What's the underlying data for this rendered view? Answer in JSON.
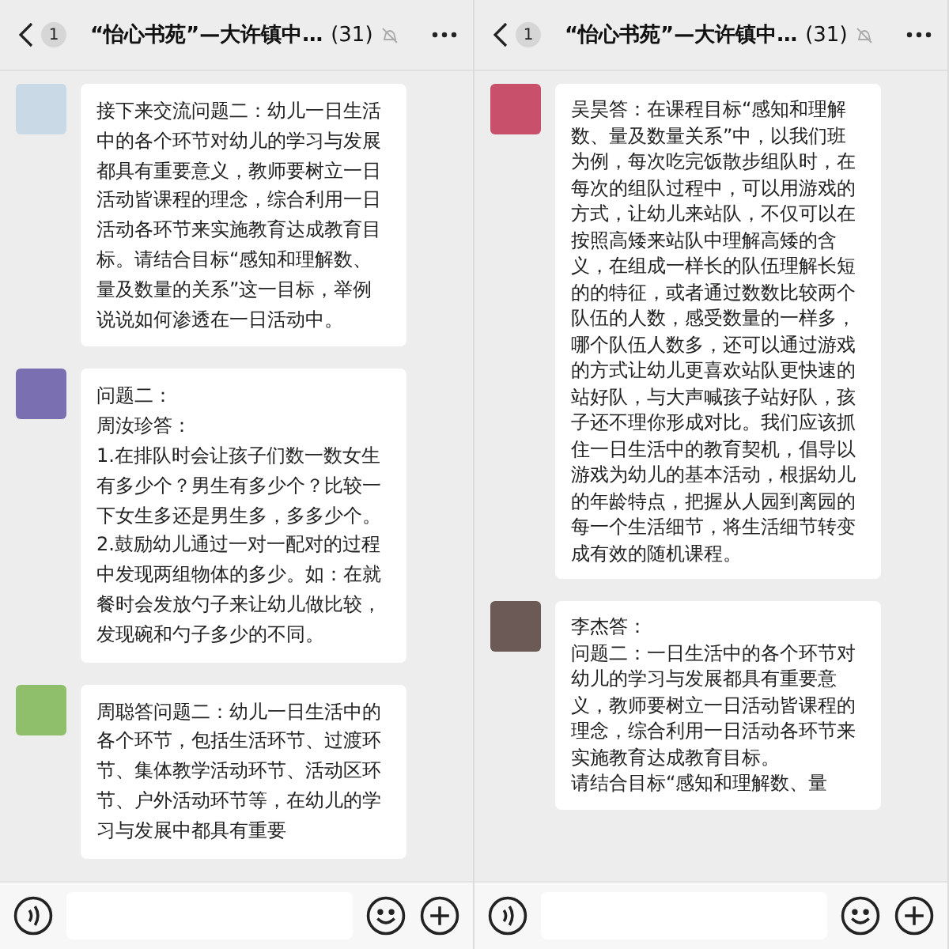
{
  "panes": [
    {
      "header": {
        "unread_count": "1",
        "title": "“怡心书苑”—大许镇中…",
        "member_count": "(31)"
      },
      "messages": [
        {
          "paragraphs": [
            "接下来交流问题二：幼儿一日生活中的各个环节对幼儿的学习与发展都具有重要意义，教师要树立一日活动皆课程的理念，综合利用一日活动各环节来实施教育达成教育目标。请结合目标“感知和理解数、量及数量的关系”这一目标，举例说说如何渗透在一日活动中。"
          ]
        },
        {
          "paragraphs": [
            "问题二：",
            "周汝珍答：",
            "1.在排队时会让孩子们数一数女生有多少个？男生有多少个？比较一下女生多还是男生多，多多少个。",
            "2.鼓励幼儿通过一对一配对的过程中发现两组物体的多少。如：在就餐时会发放勺子来让幼儿做比较，发现碗和勺子多少的不同。"
          ]
        },
        {
          "paragraphs": [
            "周聪答问题二：幼儿一日生活中的各个环节，包括生活环节、过渡环节、集体教学活动环节、活动区环节、户外活动环节等，在幼儿的学习与发展中都具有重要"
          ]
        }
      ]
    },
    {
      "header": {
        "unread_count": "1",
        "title": "“怡心书苑”—大许镇中…",
        "member_count": "(31)"
      },
      "messages": [
        {
          "paragraphs": [
            "吴昊答：在课程目标“感知和理解数、量及数量关系”中，以我们班为例，每次吃完饭散步组队时，在每次的组队过程中，可以用游戏的方式，让幼儿来站队，不仅可以在按照高矮来站队中理解高矮的含义，在组成一样长的队伍理解长短的的特征，或者通过数数比较两个队伍的人数，感受数量的一样多，哪个队伍人数多，还可以通过游戏的方式让幼儿更喜欢站队更快速的站好队，与大声喊孩子站好队，孩子还不理你形成对比。我们应该抓住一日生活中的教育契机，倡导以游戏为幼儿的基本活动，根据幼儿的年龄特点，把握从人园到离园的每一个生活细节，将生活细节转变成有效的随机课程。"
          ]
        },
        {
          "paragraphs": [
            "李杰答：",
            "问题二：一日生活中的各个环节对幼儿的学习与发展都具有重要意义，教师要树立一日活动皆课程的理念，综合利用一日活动各环节来实施教育达成教育目标。",
            "请结合目标“感知和理解数、量"
          ]
        }
      ]
    }
  ]
}
